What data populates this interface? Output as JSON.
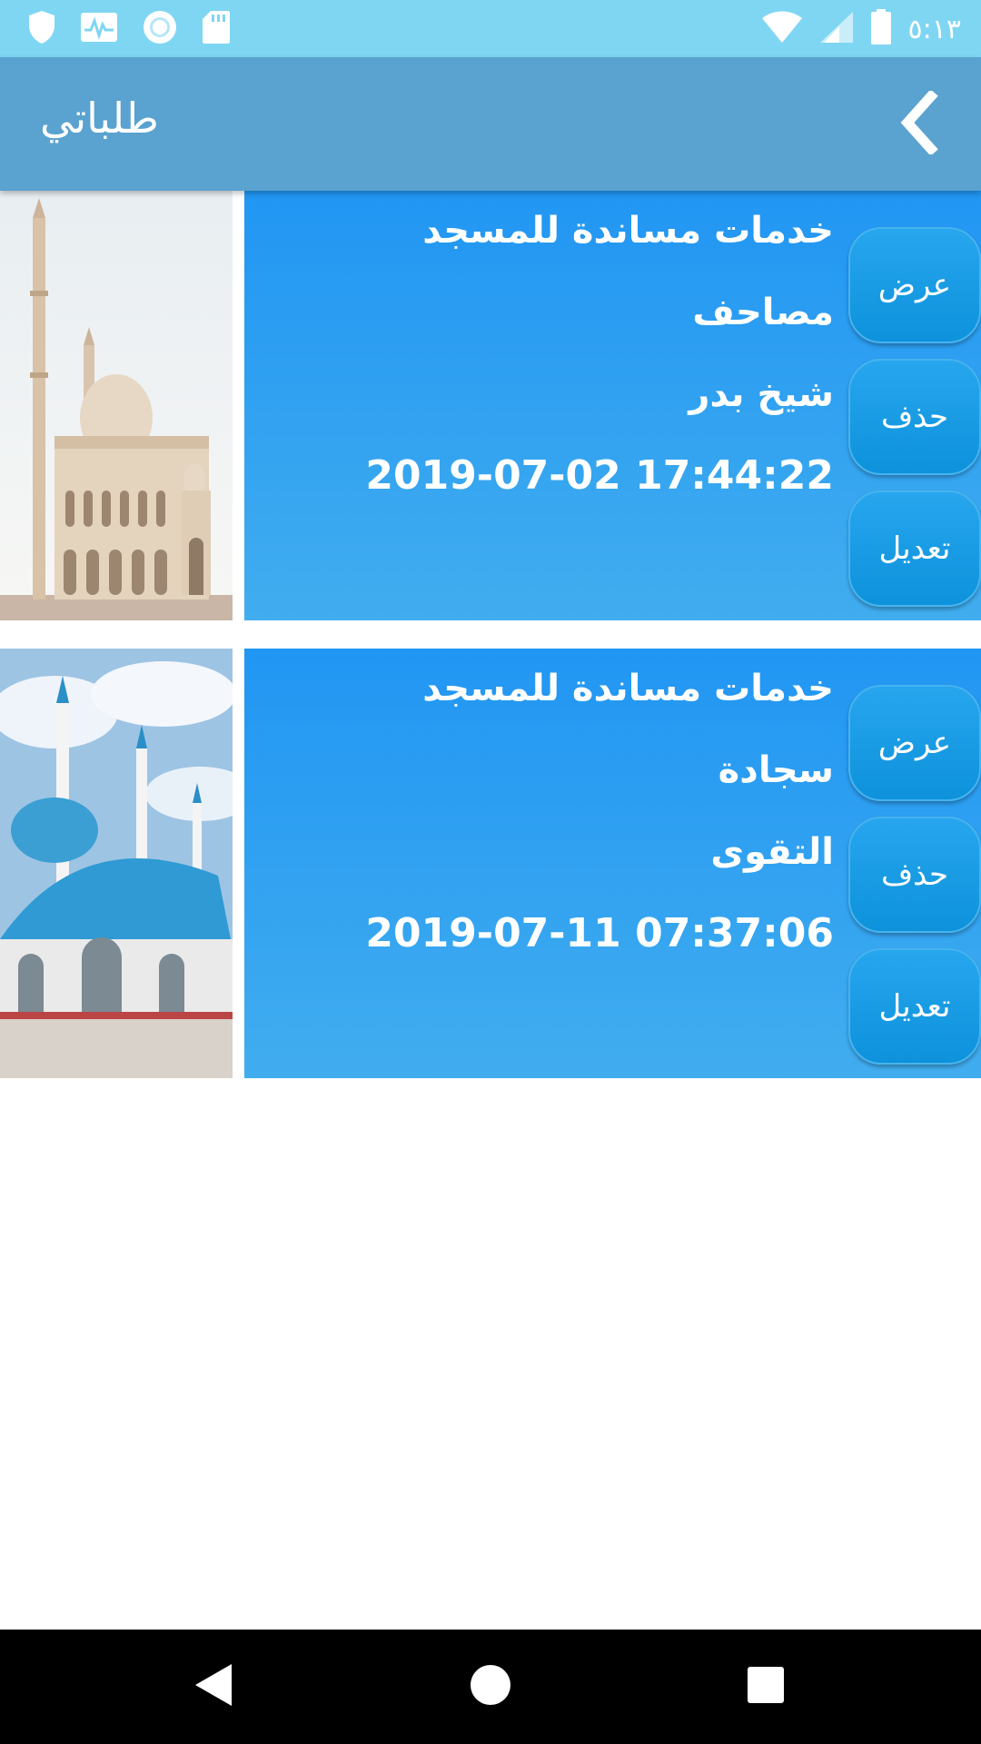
{
  "status_bar": {
    "time": "٥:١٣",
    "left_icons": [
      "shield-icon",
      "activity-icon",
      "circle-icon",
      "sd-card-icon"
    ],
    "right_icons": [
      "wifi-icon",
      "signal-icon",
      "battery-icon"
    ]
  },
  "toolbar": {
    "title": "طلباتي",
    "back_icon": "chevron-left-icon"
  },
  "requests": [
    {
      "image": "mosque-photo",
      "service": "خدمات مساندة للمسجد",
      "item": "مصاحف",
      "mosque": "شيخ بدر",
      "datetime": "2019-07-02 17:44:22",
      "buttons": {
        "view": "عرض",
        "delete": "حذف",
        "edit": "تعديل"
      }
    },
    {
      "image": "mosque-photo",
      "service": "خدمات مساندة للمسجد",
      "item": "سجادة",
      "mosque": "التقوى",
      "datetime": "2019-07-11 07:37:06",
      "buttons": {
        "view": "عرض",
        "delete": "حذف",
        "edit": "تعديل"
      }
    }
  ],
  "nav_bar": {
    "icons": [
      "back-triangle-icon",
      "home-circle-icon",
      "recents-square-icon"
    ]
  },
  "colors": {
    "status_bar": "#7fd6f2",
    "toolbar": "#5aa2cf",
    "card": "#2196f3",
    "button": "#1a9de6"
  }
}
